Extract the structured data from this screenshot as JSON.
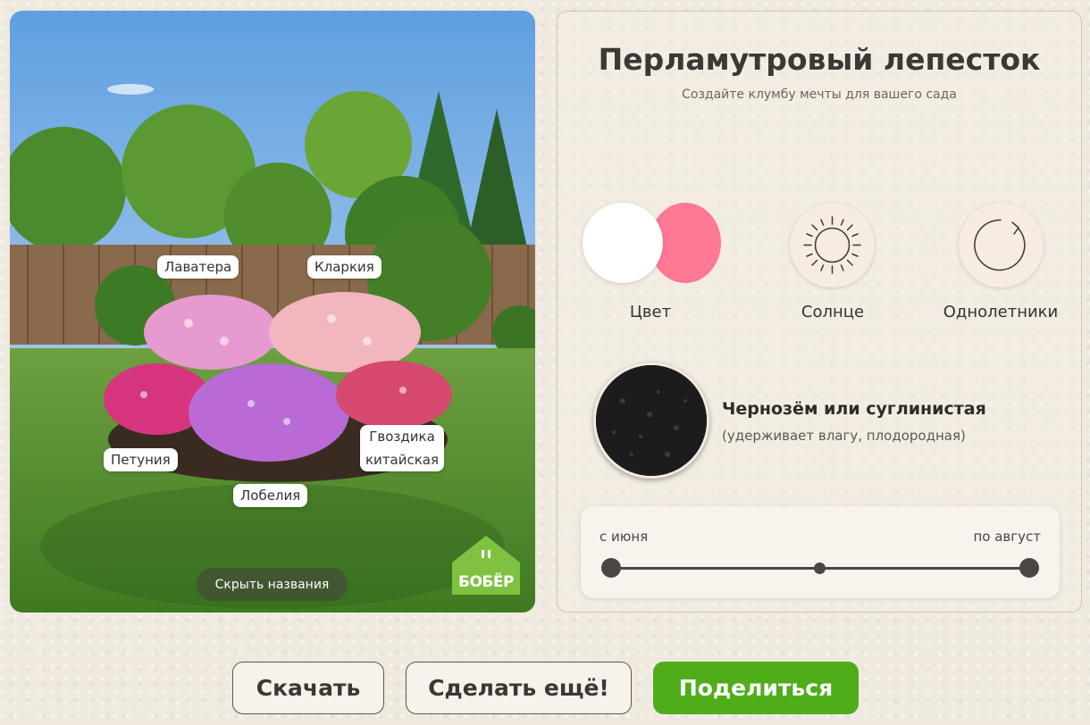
{
  "scene": {
    "labels": {
      "lavatera": "Лаватера",
      "clarkia": "Кларкия",
      "petunia": "Петуния",
      "dianthus_line1": "Гвоздика",
      "dianthus_line2": "китайская",
      "lobelia": "Лобелия"
    },
    "hide_names_button": "Скрыть названия",
    "logo_text": "БОБЁР"
  },
  "card": {
    "title": "Перламутровый лепесток",
    "subtitle": "Создайте клумбу мечты для вашего сада",
    "features": [
      {
        "label": "Цвет",
        "icon": "color-swatch-icon",
        "colors": [
          "#ffffff",
          "#ff7894"
        ]
      },
      {
        "label": "Солнце",
        "icon": "sun-icon"
      },
      {
        "label": "Однолетники",
        "icon": "annual-cycle-icon"
      }
    ],
    "soil": {
      "title": "Чернозём или суглинистая",
      "subtitle": "(удерживает влагу, плодородная)"
    },
    "period": {
      "from": "с июня",
      "to": "по август"
    }
  },
  "buttons": {
    "download": "Скачать",
    "again": "Сделать ещё!",
    "share": "Поделиться"
  },
  "colors": {
    "accent_green": "#4fad1a",
    "page_bg": "#efe9e0",
    "logo_green": "#7fc241"
  }
}
